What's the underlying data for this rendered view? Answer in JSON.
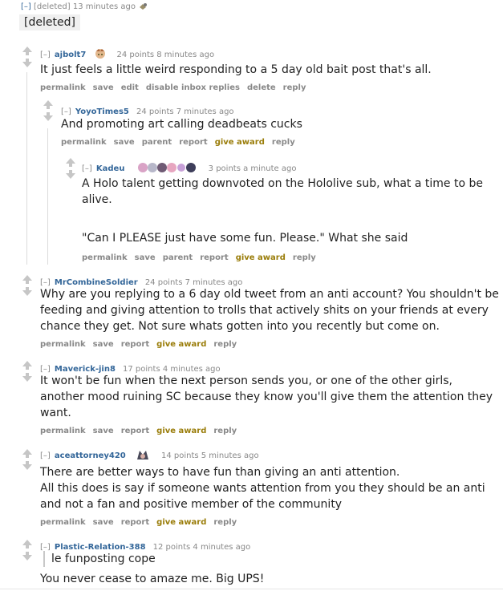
{
  "top": {
    "toggle": "[–]",
    "author": "[deleted]",
    "time": "13 minutes ago",
    "body": "[deleted]"
  },
  "comments": [
    {
      "toggle": "[–]",
      "author": "ajbolt7",
      "score": "24 points 8 minutes ago",
      "body": [
        "It just feels a little weird responding to a 5 day old bait post that's all."
      ],
      "buttons": [
        "permalink",
        "save",
        "edit",
        "disable inbox replies",
        "delete",
        "reply"
      ]
    },
    {
      "toggle": "[–]",
      "author": "YoyoTimes5",
      "score": "24 points 7 minutes ago",
      "body": [
        "And promoting art calling deadbeats cucks"
      ],
      "buttons": [
        "permalink",
        "save",
        "parent",
        "report",
        "give award",
        "reply"
      ]
    },
    {
      "toggle": "[–]",
      "author": "Kadeu",
      "score": "3 points a minute ago",
      "body": [
        "A Holo talent getting downvoted on the Hololive sub, what a time to be",
        "alive.",
        "\"Can I PLEASE just have some fun. Please.\" What she said"
      ],
      "buttons": [
        "permalink",
        "save",
        "parent",
        "report",
        "give award",
        "reply"
      ]
    },
    {
      "toggle": "[–]",
      "author": "MrCombineSoldier",
      "score": "24 points 7 minutes ago",
      "body": [
        "Why are you replying to a 6 day old tweet from an anti account? You shouldn't be",
        "feeding and giving attention to trolls that actively shits on your friends at every",
        "chance they get. Not sure whats gotten into you recently but come on."
      ],
      "buttons": [
        "permalink",
        "save",
        "report",
        "give award",
        "reply"
      ]
    },
    {
      "toggle": "[–]",
      "author": "Maverick-jin8",
      "score": "17 points 4 minutes ago",
      "body": [
        "It won't be fun when the next person sends you, or one of the other girls,",
        "another mood ruining SC because they know you'll give them the attention they",
        "want."
      ],
      "buttons": [
        "permalink",
        "save",
        "report",
        "give award",
        "reply"
      ]
    },
    {
      "toggle": "[–]",
      "author": "aceattorney420",
      "score": "14 points 5 minutes ago",
      "body": [
        "There are better ways to have fun than giving an anti attention.",
        "All this does is say if someone wants attention from you they should be an anti",
        "and not a fan and positive member of the community"
      ],
      "buttons": [
        "permalink",
        "save",
        "report",
        "give award",
        "reply"
      ]
    },
    {
      "toggle": "[–]",
      "author": "Plastic-Relation-388",
      "score": "12 points 4 minutes ago",
      "quote": "le funposting cope",
      "body": [
        "You never cease to amaze me. Big UPS!"
      ]
    }
  ],
  "colors": {
    "username": "#336699",
    "meta": "#888888",
    "award": "#9a7d0a",
    "vote_arrow": "#c6c6c6"
  }
}
